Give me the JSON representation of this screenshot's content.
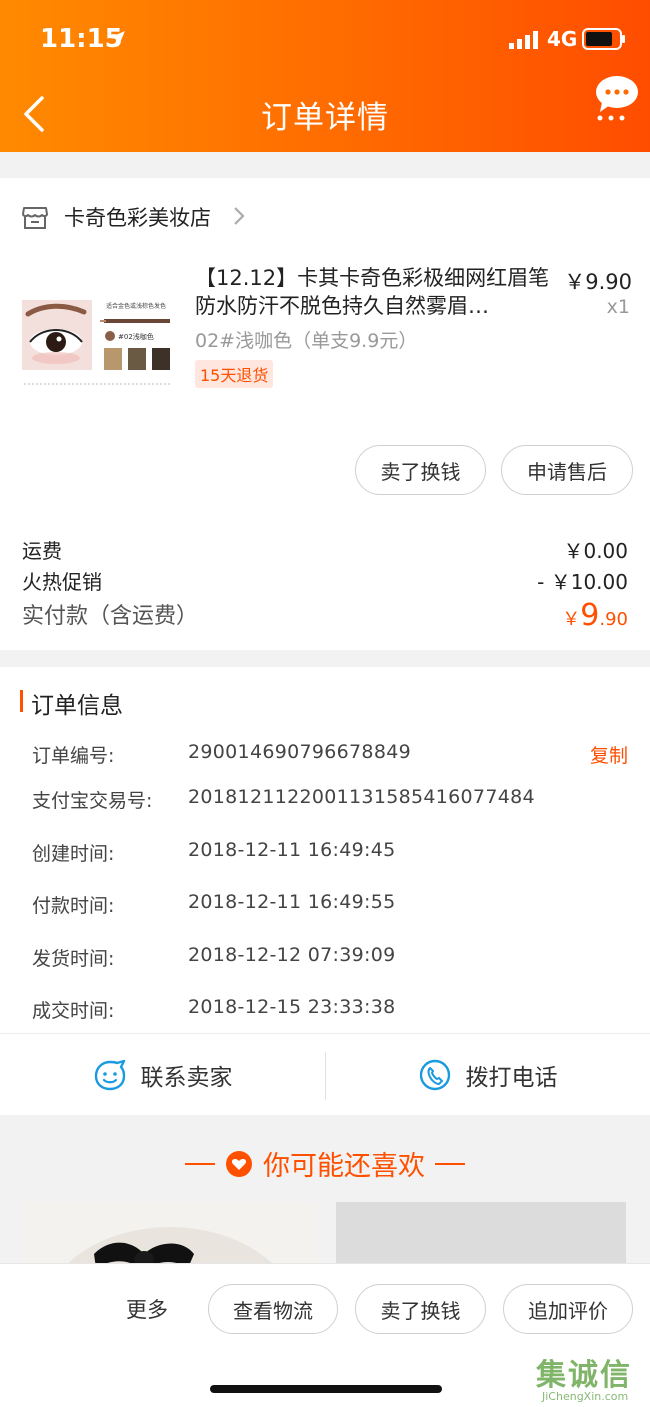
{
  "status_bar": {
    "time": "11:15",
    "network": "4G"
  },
  "nav": {
    "title": "订单详情"
  },
  "shop": {
    "name": "卡奇色彩美妆店"
  },
  "product": {
    "title": "【12.12】卡其卡奇色彩极细网红眉笔防水防汗不脱色持久自然雾眉…",
    "price": "￥9.90",
    "qty": "x1",
    "sku": "02#浅咖色（单支9.9元）",
    "return_policy": "15天退货",
    "thumb_caption_top": "适合金色或浅棕色发色",
    "thumb_caption_shade": "#02浅咖色"
  },
  "item_actions": {
    "sell": "卖了换钱",
    "after_sale": "申请售后"
  },
  "fees": {
    "shipping_label": "运费",
    "shipping_value": "￥0.00",
    "promo_label": "火热促销",
    "promo_value": "- ￥10.00",
    "paid_label": "实付款（含运费）",
    "paid_currency": "￥",
    "paid_int": "9",
    "paid_dec": ".90"
  },
  "order_info": {
    "title": "订单信息",
    "copy_label": "复制",
    "rows": [
      {
        "label": "订单编号:",
        "value": "290014690796678849"
      },
      {
        "label": "支付宝交易号:",
        "value": "2018121122001131585416077484"
      },
      {
        "label": "创建时间:",
        "value": "2018-12-11 16:49:45"
      },
      {
        "label": "付款时间:",
        "value": "2018-12-11 16:49:55"
      },
      {
        "label": "发货时间:",
        "value": "2018-12-12 07:39:09"
      },
      {
        "label": "成交时间:",
        "value": "2018-12-15 23:33:38"
      }
    ]
  },
  "contact": {
    "seller": "联系卖家",
    "phone": "拨打电话"
  },
  "recommend": {
    "title": "你可能还喜欢"
  },
  "bottom": {
    "more": "更多",
    "logistics": "查看物流",
    "sell": "卖了换钱",
    "review": "追加评价"
  },
  "watermark": {
    "cn": "集诚信",
    "en": "JiChengXin.com"
  },
  "colors": {
    "accent": "#ff5000",
    "header_start": "#ff8a00",
    "header_end": "#ff4d00"
  },
  "icons": [
    "location-icon",
    "signal-icon",
    "battery-icon",
    "back-icon",
    "message-more-icon",
    "shop-icon",
    "chevron-right-icon",
    "smile-chat-icon",
    "phone-icon",
    "heart-icon"
  ]
}
